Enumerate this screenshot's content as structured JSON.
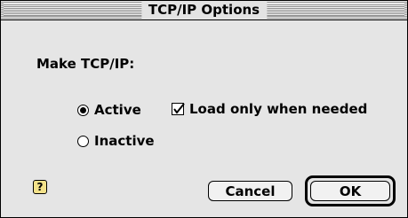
{
  "dialog": {
    "title": "TCP/IP Options",
    "make_label": "Make TCP/IP:",
    "options": [
      {
        "label": "Active",
        "selected": true
      },
      {
        "label": "Inactive",
        "selected": false
      }
    ],
    "load_on_demand": {
      "label": "Load only when needed",
      "checked": true
    },
    "help_icon": "question-mark",
    "buttons": {
      "cancel": "Cancel",
      "ok": "OK"
    }
  }
}
